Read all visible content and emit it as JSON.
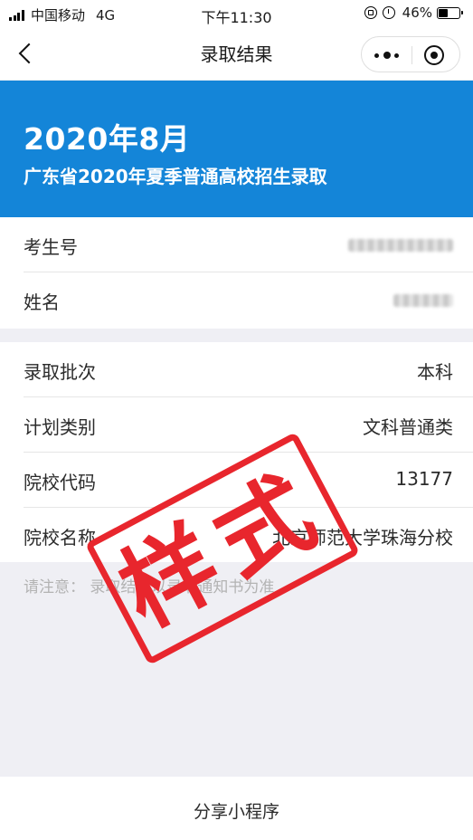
{
  "status_bar": {
    "carrier": "中国移动",
    "network": "4G",
    "time": "下午11:30",
    "battery_percent": "46%",
    "battery_level": 0.46
  },
  "nav": {
    "title": "录取结果",
    "icons": [
      "back-chevron-icon",
      "more-dots-icon",
      "close-target-icon"
    ]
  },
  "banner": {
    "date": "2020年8月",
    "subtitle": "广东省2020年夏季普通高校招生录取"
  },
  "student": {
    "rows": [
      {
        "label": "考生号",
        "value_hidden": true
      },
      {
        "label": "姓名",
        "value_hidden": true
      }
    ]
  },
  "admission": {
    "rows": [
      {
        "label": "录取批次",
        "value": "本科"
      },
      {
        "label": "计划类别",
        "value": "文科普通类"
      },
      {
        "label": "院校代码",
        "value": "13177"
      },
      {
        "label": "院校名称",
        "value": "北京师范大学珠海分校"
      }
    ]
  },
  "note": "请注意：  录取结果以录取通知书为准",
  "stamp": {
    "text": "样式",
    "color": "#e8262d"
  },
  "footer": {
    "share_label": "分享小程序"
  },
  "colors": {
    "banner": "#1485d8",
    "background": "#efeff4"
  }
}
